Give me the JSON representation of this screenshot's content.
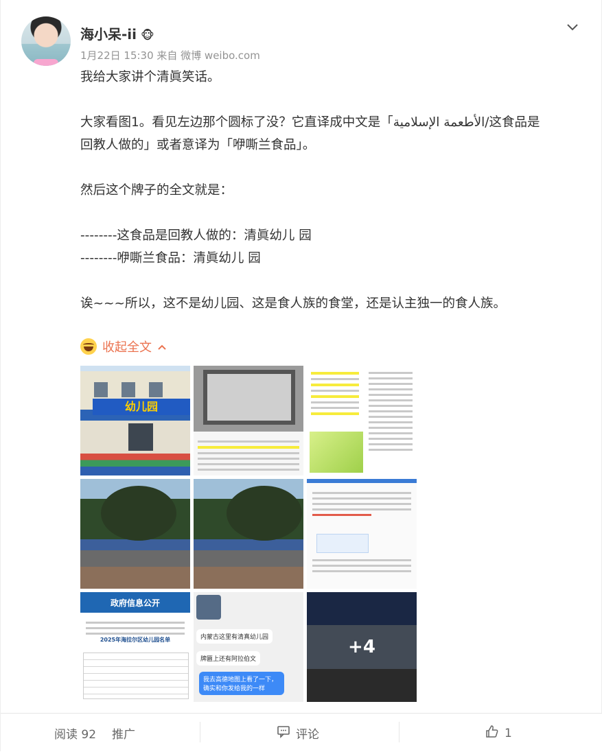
{
  "post": {
    "username": "海小呆-ii",
    "vip_badge": "🐵",
    "meta": "1月22日 15:30 来自 微博 weibo.com",
    "paragraphs": [
      "我给大家讲个清眞笑话。",
      "",
      "大家看图1。看见左边那个圆标了没？它直译成中文是「الأطعمة الإسلامية/这食品是",
      "回教人做的」或者意译为「咿嘶兰食品」。",
      "",
      "然后这个牌子的全文就是：",
      "",
      "--------这食品是回教人做的：清眞幼儿  园",
      "--------咿嘶兰食品：清眞幼儿  园",
      "",
      "诶~~~所以，这不是幼儿园、这是食人族的食堂，还是认主独一的食人族。"
    ],
    "collapse_label": "收起全文"
  },
  "images": {
    "t1_sign": "幼儿园",
    "t7_banner": "政府信息公开",
    "t7_subtitle": "2025年海拉尔区幼儿园名单",
    "t8_bubble1": "内蒙古这里有清真幼儿园",
    "t8_bubble2": "牌匾上还有阿拉伯文",
    "t8_bubble3": "我去高德地图上看了一下，确实和你发给我的一样",
    "more_count": "+4"
  },
  "footer": {
    "reads": "阅读 92",
    "promote": "推广",
    "comment": "评论",
    "likes": "1"
  },
  "colors": {
    "accent": "#eb7350",
    "meta": "#939393",
    "text": "#333333"
  }
}
